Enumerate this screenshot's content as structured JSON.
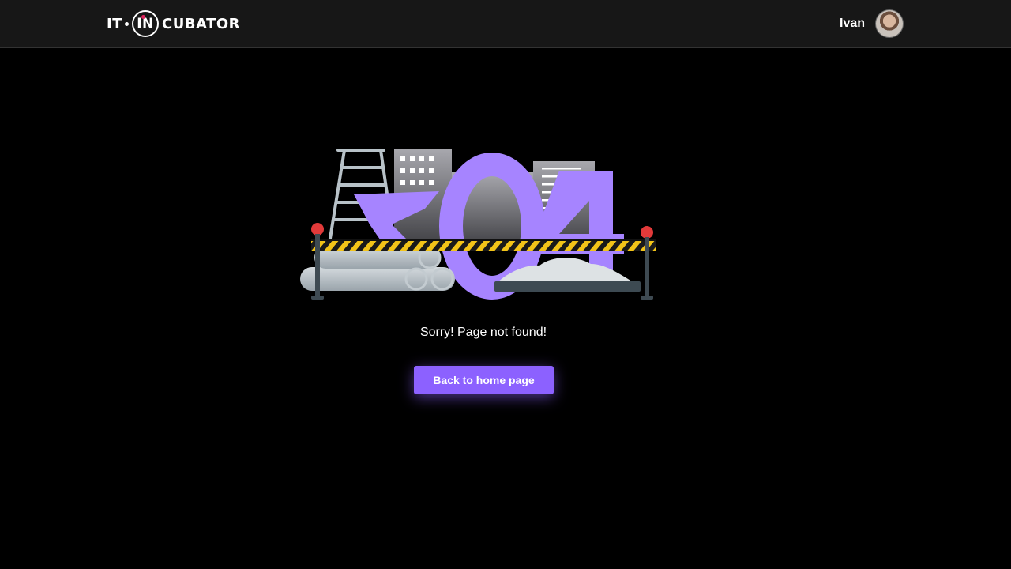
{
  "header": {
    "logo": {
      "left": "IT",
      "circled": "IN",
      "right": "CUBATOR"
    },
    "user": {
      "name": "Ivan"
    }
  },
  "illustration": {
    "code": "404",
    "accent_color": "#8c61ff"
  },
  "main": {
    "message": "Sorry! Page not found!",
    "back_button_label": "Back to home page"
  },
  "colors": {
    "background": "#000000",
    "header_background": "#171717",
    "accent": "#8c61ff"
  }
}
